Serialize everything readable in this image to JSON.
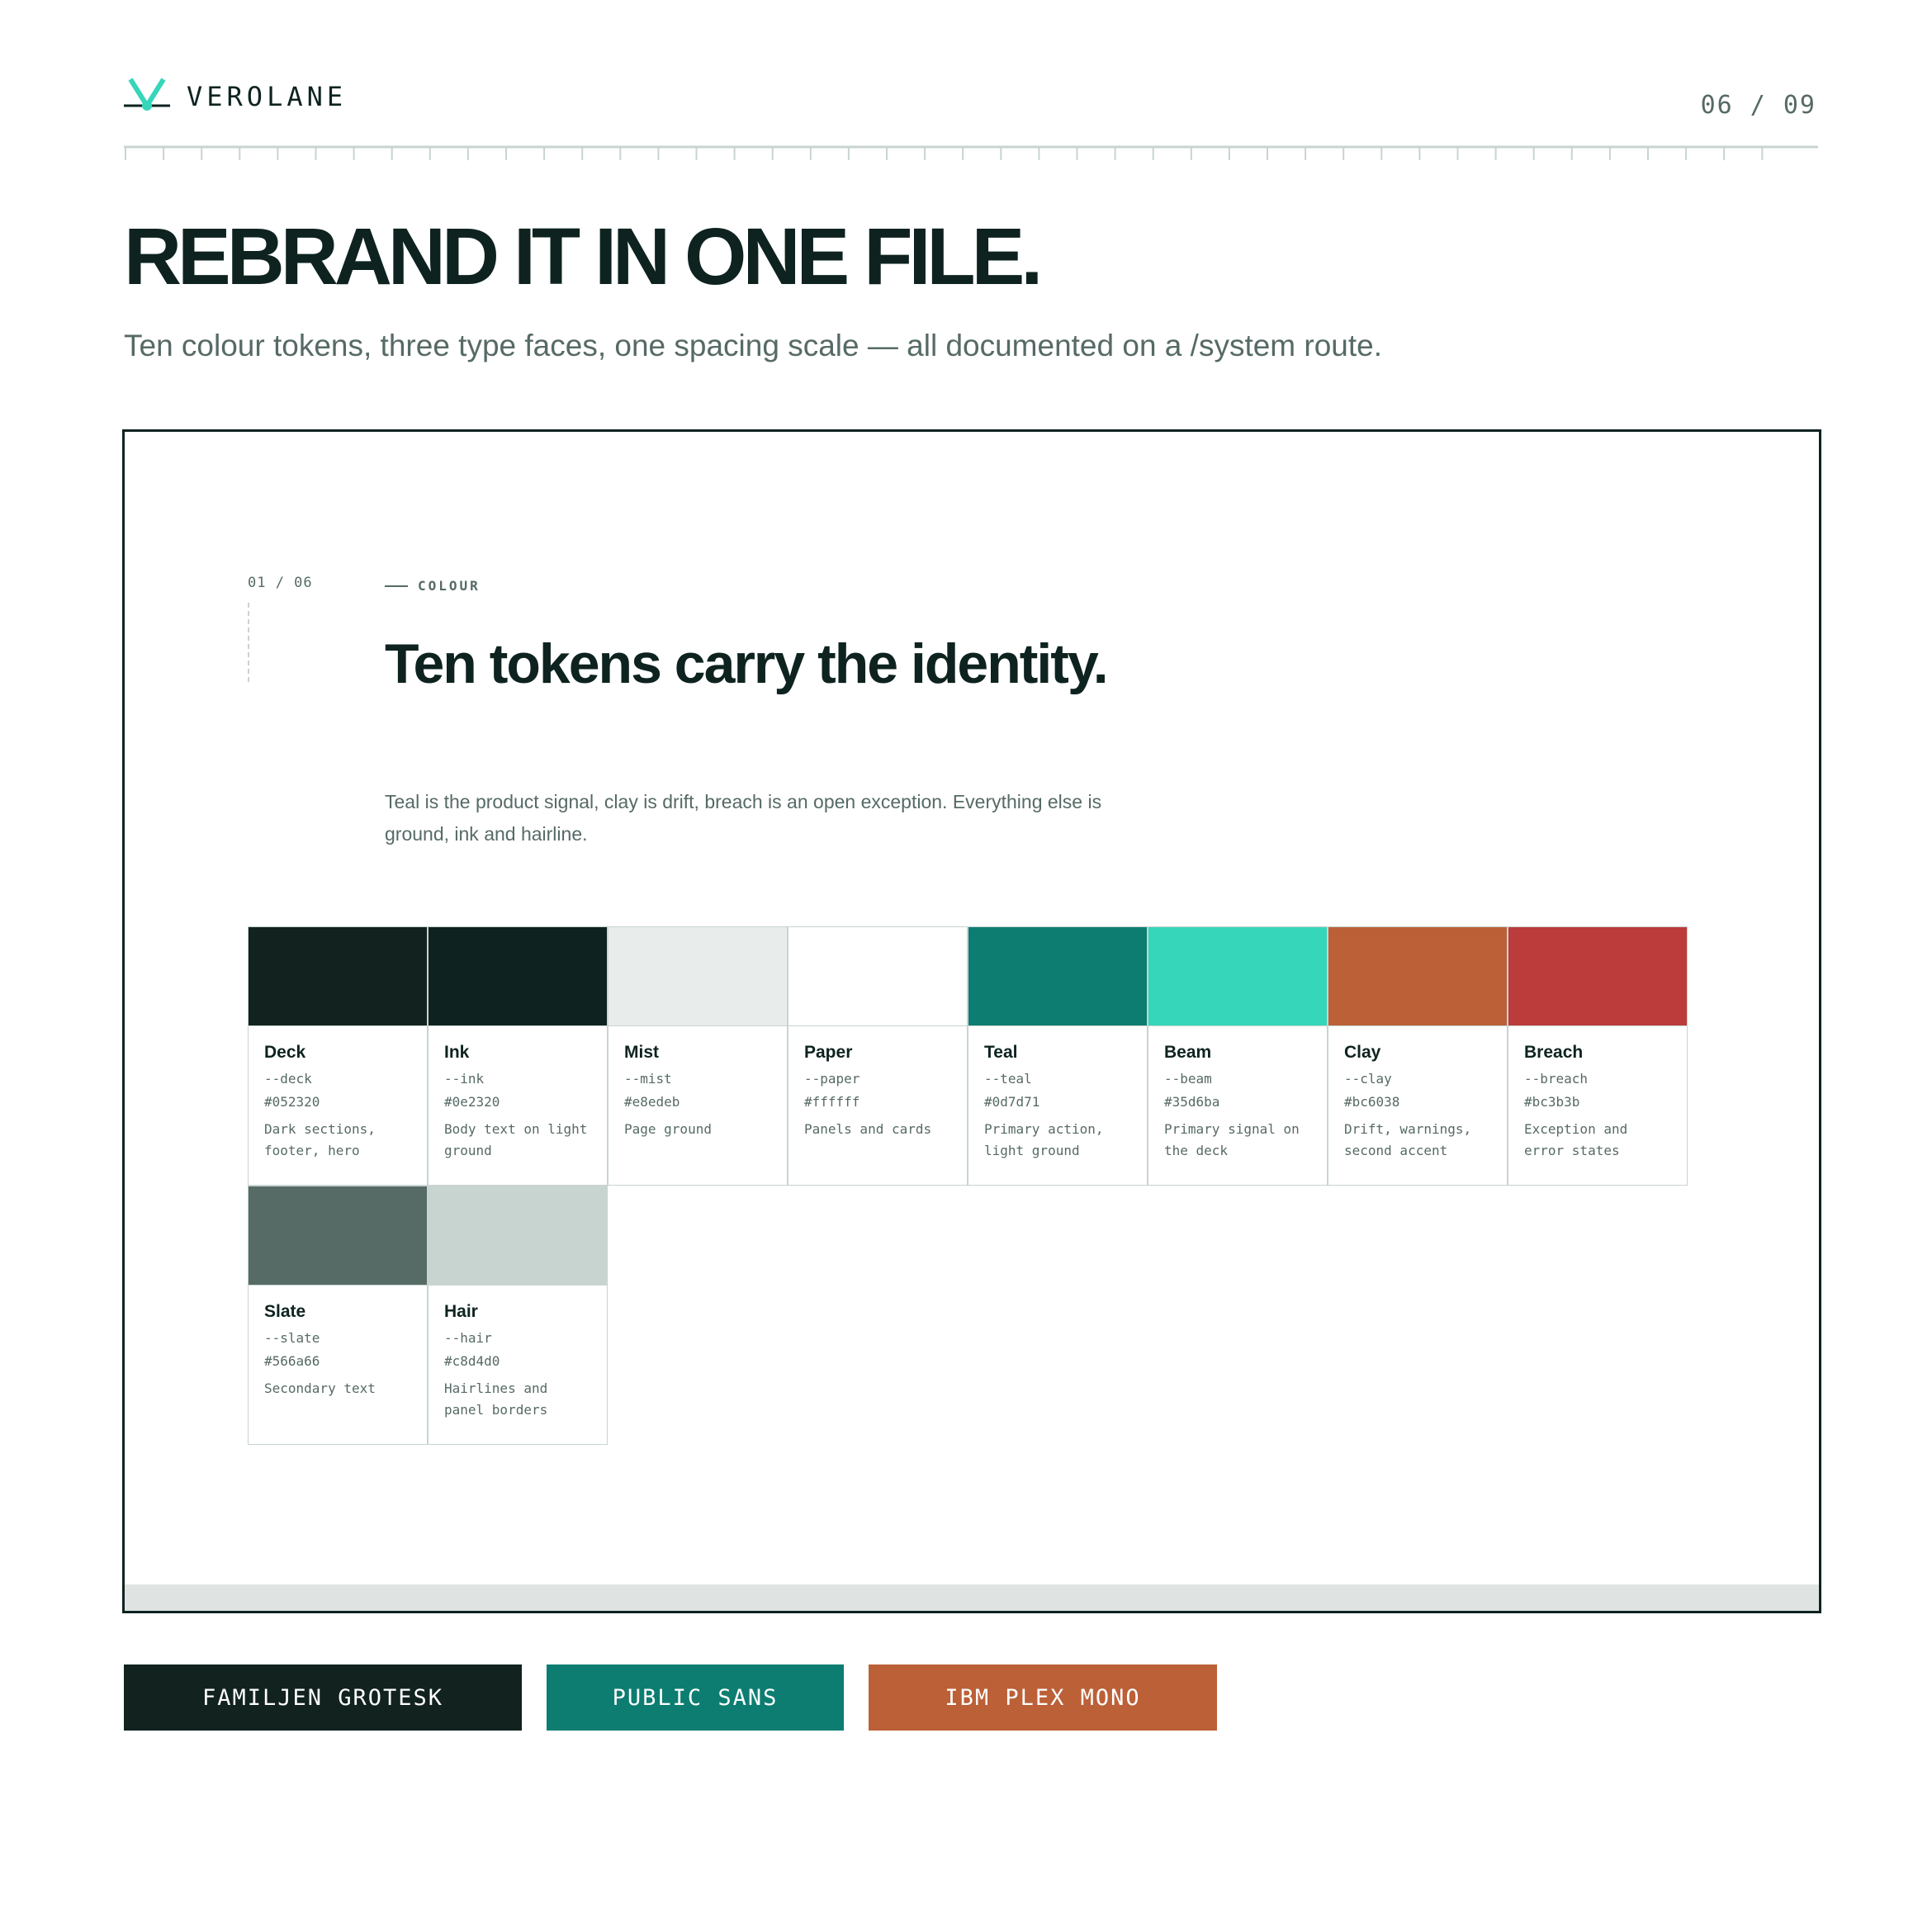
{
  "header": {
    "brand": "VEROLANE",
    "page_indicator": "06 / 09",
    "logo_color": "#35d6ba"
  },
  "hero": {
    "title": "REBRAND IT IN ONE FILE.",
    "subtitle": "Ten colour tokens, three type faces, one spacing scale — all documented on a /system route."
  },
  "screenshot": {
    "section_index": "01 / 06",
    "eyebrow": "COLOUR",
    "title": "Ten tokens carry the identity.",
    "body": "Teal is the product signal, clay is drift, breach is an open exception. Everything else is ground, ink and hairline.",
    "tokens": [
      {
        "name": "Deck",
        "var": "--deck",
        "hex": "#052320",
        "desc": "Dark sections, footer, hero",
        "color": "#11221f"
      },
      {
        "name": "Ink",
        "var": "--ink",
        "hex": "#0e2320",
        "desc": "Body text on light ground",
        "color": "#0e2320"
      },
      {
        "name": "Mist",
        "var": "--mist",
        "hex": "#e8edeb",
        "desc": "Page ground",
        "color": "#e8edeb"
      },
      {
        "name": "Paper",
        "var": "--paper",
        "hex": "#ffffff",
        "desc": "Panels and cards",
        "color": "#ffffff"
      },
      {
        "name": "Teal",
        "var": "--teal",
        "hex": "#0d7d71",
        "desc": "Primary action, light ground",
        "color": "#0d7d71"
      },
      {
        "name": "Beam",
        "var": "--beam",
        "hex": "#35d6ba",
        "desc": "Primary signal on the deck",
        "color": "#35d6ba"
      },
      {
        "name": "Clay",
        "var": "--clay",
        "hex": "#bc6038",
        "desc": "Drift, warnings, second accent",
        "color": "#bc6038"
      },
      {
        "name": "Breach",
        "var": "--breach",
        "hex": "#bc3b3b",
        "desc": "Exception and error states",
        "color": "#bc3b3b"
      },
      {
        "name": "Slate",
        "var": "--slate",
        "hex": "#566a66",
        "desc": "Secondary text",
        "color": "#566a66"
      },
      {
        "name": "Hair",
        "var": "--hair",
        "hex": "#c8d4d0",
        "desc": "Hairlines and panel borders",
        "color": "#c8d4d0"
      }
    ]
  },
  "typefaces": [
    {
      "label": "FAMILJEN GROTESK",
      "color": "#11221f"
    },
    {
      "label": "PUBLIC SANS",
      "color": "#0d7d71"
    },
    {
      "label": "IBM PLEX MONO",
      "color": "#bc6038"
    }
  ]
}
